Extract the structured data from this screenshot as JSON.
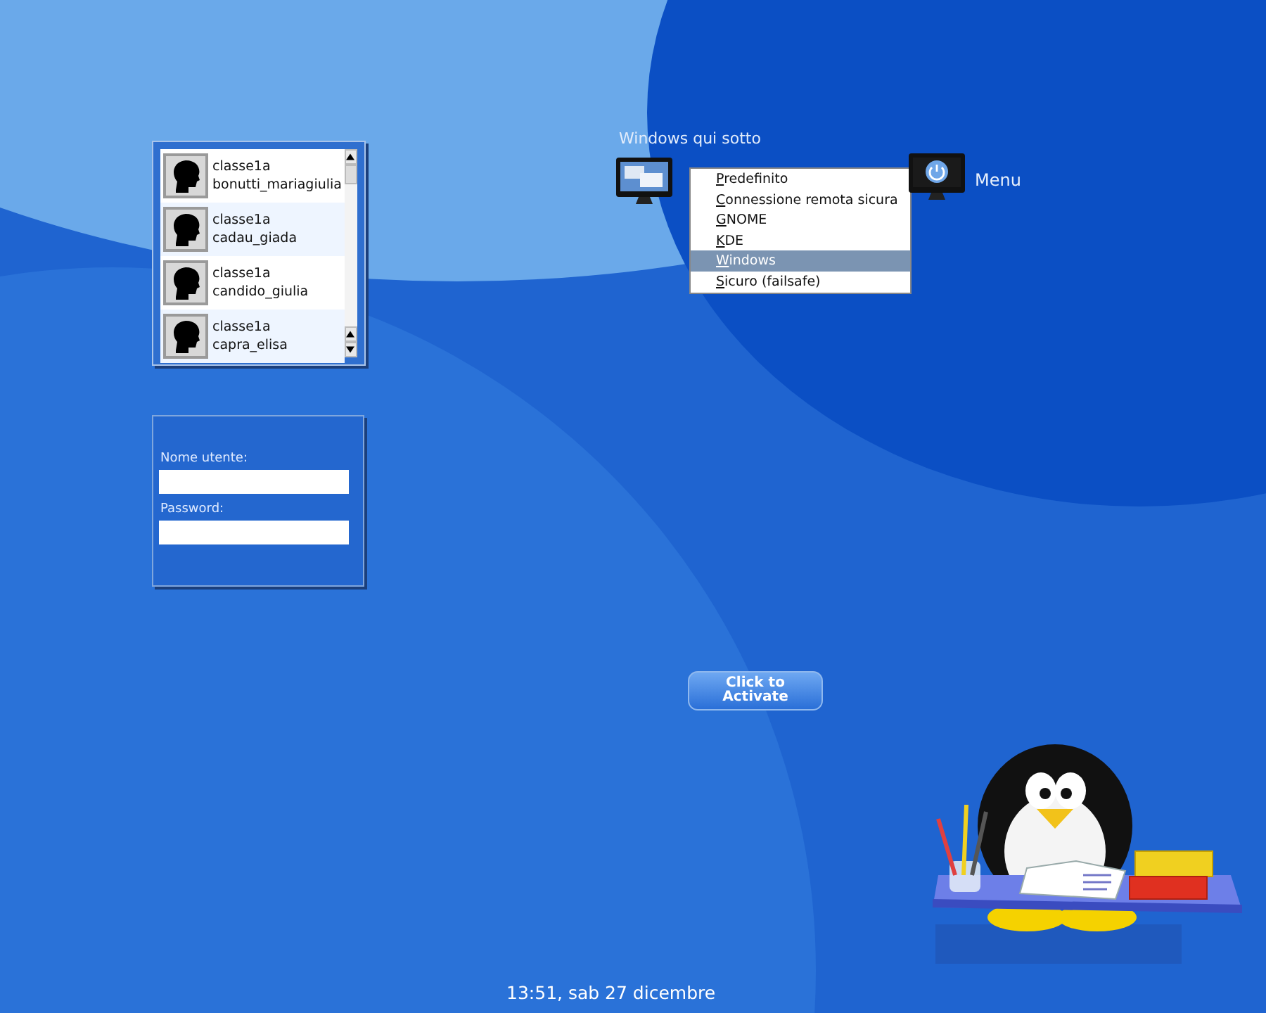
{
  "user_list": {
    "users": [
      {
        "group": "classe1a",
        "name": "bonutti_mariagiulia",
        "selected": false
      },
      {
        "group": "classe1a",
        "name": "cadau_giada",
        "selected": false
      },
      {
        "group": "classe1a",
        "name": "candido_giulia",
        "selected": false
      },
      {
        "group": "classe1a",
        "name": "capra_elisa",
        "selected": false
      }
    ]
  },
  "login_form": {
    "username_label": "Nome utente:",
    "password_label": "Password:"
  },
  "session": {
    "label": "Windows qui sotto",
    "items": [
      {
        "label": "Predefinito",
        "selected": false
      },
      {
        "label": "Connessione remota sicura",
        "selected": false
      },
      {
        "label": "GNOME",
        "selected": false
      },
      {
        "label": "KDE",
        "selected": false
      },
      {
        "label": "Windows",
        "selected": true
      },
      {
        "label": "Sicuro (failsafe)",
        "selected": false
      }
    ]
  },
  "menu": {
    "label": "Menu"
  },
  "activate_button": {
    "label": "Click to Activate"
  },
  "clock": "13:51, sab 27 dicembre"
}
